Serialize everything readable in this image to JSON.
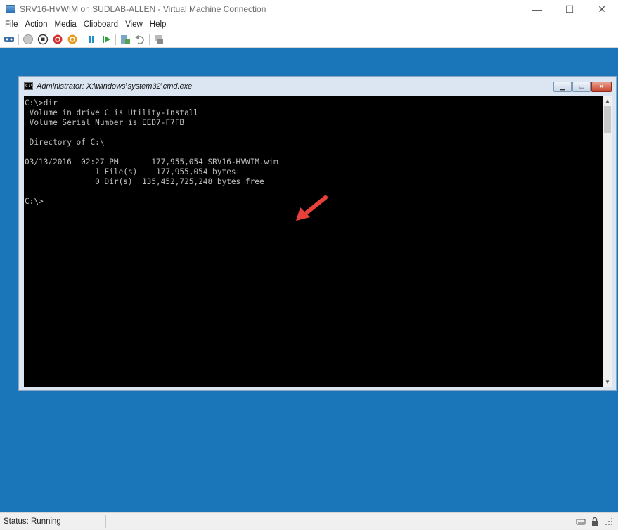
{
  "window": {
    "title": "SRV16-HVWIM on SUDLAB-ALLEN - Virtual Machine Connection",
    "minimize": "—",
    "maximize": "☐",
    "close": "✕"
  },
  "menu": [
    "File",
    "Action",
    "Media",
    "Clipboard",
    "View",
    "Help"
  ],
  "toolbar": {
    "icons": [
      "ctrl-alt-del-icon",
      "start-icon",
      "turn-off-icon",
      "shut-down-icon",
      "save-icon",
      "pause-icon",
      "reset-icon",
      "checkpoint-icon",
      "revert-icon",
      "enhanced-session-icon"
    ]
  },
  "cmd": {
    "title": "Administrator: X:\\windows\\system32\\cmd.exe",
    "icon_text": "C:\\",
    "lines": [
      "C:\\>dir",
      " Volume in drive C is Utility-Install",
      " Volume Serial Number is EED7-F7FB",
      "",
      " Directory of C:\\",
      "",
      "03/13/2016  02:27 PM       177,955,054 SRV16-HVWIM.wim",
      "               1 File(s)    177,955,054 bytes",
      "               0 Dir(s)  135,452,725,248 bytes free",
      "",
      "C:\\>"
    ],
    "caption_min": "▁",
    "caption_max": "▭",
    "caption_close": "✕",
    "scroll_up": "▲",
    "scroll_down": "▼"
  },
  "annotation": {
    "arrow_color": "#e8413a"
  },
  "status": {
    "text": "Status: Running"
  },
  "colors": {
    "desktop": "#1b76b9",
    "console_bg": "#000000",
    "console_fg": "#c0c0c0"
  }
}
